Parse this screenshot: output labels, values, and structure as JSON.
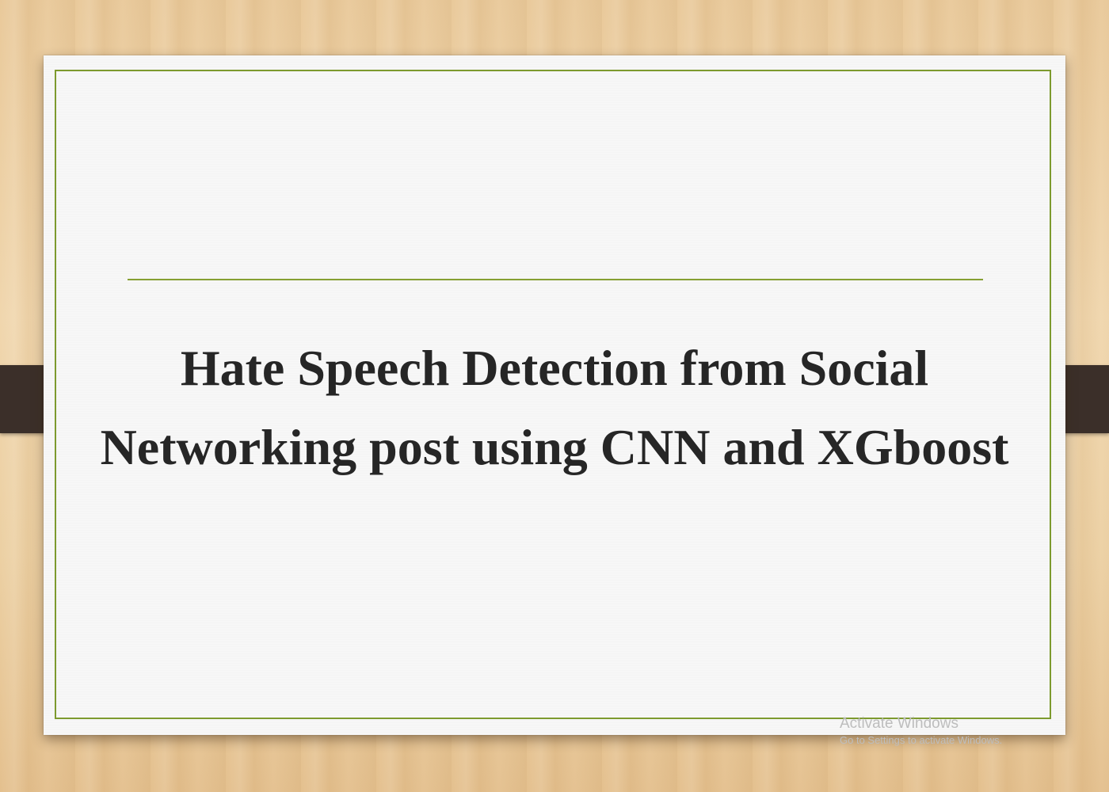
{
  "slide": {
    "title_line1": "Hate Speech Detection from Social",
    "title_line2": "Networking post using CNN and XGboost"
  },
  "watermark": {
    "title": "Activate Windows",
    "subtitle": "Go to Settings to activate Windows."
  },
  "colors": {
    "frame": "#7d9a2e",
    "title_text": "#262626",
    "tab": "#3b2f29",
    "paper": "#f7f7f7"
  }
}
